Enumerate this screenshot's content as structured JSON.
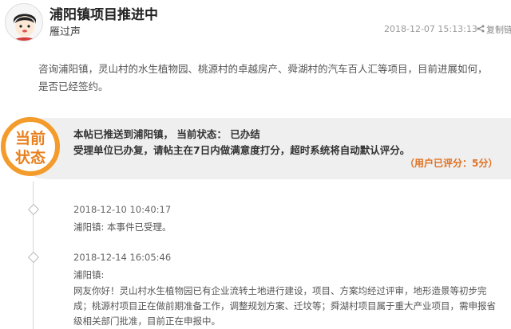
{
  "post": {
    "title": "浦阳镇项目推进中",
    "author": "雁过声",
    "timestamp": "2018-12-07 15:13:13",
    "copy_link": "复制链"
  },
  "question": "咨询浦阳镇，灵山村的水生植物园、桃源村的卓越房产、舜湖村的汽车百人汇等项目，目前进展如何，是否已经签约。",
  "status": {
    "badge_line1": "当前",
    "badge_line2": "状态",
    "line1": "本帖已推送到浦阳镇， 当前状态： 已办结",
    "line2": "受理单位已办复，请帖主在7日内做满意度打分，超时系统将自动默认评分。",
    "rating": "（用户已评分：5分）"
  },
  "timeline": [
    {
      "date": "2018-12-10 10:40:17",
      "text": "浦阳镇: 本事件已受理。"
    },
    {
      "date": "2018-12-14 16:05:46",
      "label": "浦阳镇:",
      "body": "网友你好！灵山村水生植物园已有企业流转土地进行建设，项目、方案均经过评审，地形造景等初步完成；桃源村项目正在做前期准备工作，调整规划方案、迁坟等；舜湖村项目属于重大产业项目，需申报省级相关部门批准，目前正在申报中。"
    }
  ],
  "colors": {
    "accent": "#f39b2b",
    "badge_text": "#e8801e",
    "rating": "#e07020",
    "panel_bg": "#efefef"
  }
}
